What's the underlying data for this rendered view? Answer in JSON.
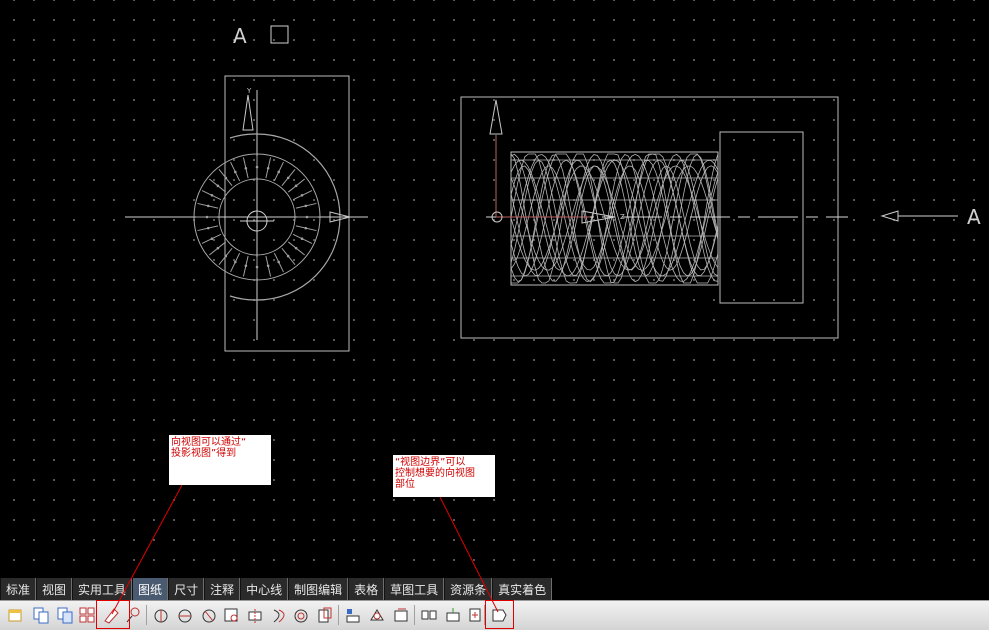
{
  "drawing": {
    "view_label_letter": "A",
    "direction_label_letter": "A"
  },
  "annotations": {
    "note1": "向视图可以通过“\n投影视图”得到",
    "note2": "“视图边界”可以\n控制想要的向视图\n部位"
  },
  "tabs": [
    {
      "label": "标准",
      "active": false
    },
    {
      "label": "视图",
      "active": false
    },
    {
      "label": "实用工具",
      "active": false
    },
    {
      "label": "图纸",
      "active": true
    },
    {
      "label": "尺寸",
      "active": false
    },
    {
      "label": "注释",
      "active": false
    },
    {
      "label": "中心线",
      "active": false
    },
    {
      "label": "制图编辑",
      "active": false
    },
    {
      "label": "表格",
      "active": false
    },
    {
      "label": "草图工具",
      "active": false
    },
    {
      "label": "资源条",
      "active": false
    },
    {
      "label": "真实着色",
      "active": false
    }
  ],
  "toolbar_icons": [
    "new-sheet-icon",
    "copy-sheet-icon",
    "paste-sheet-icon",
    "layout-icon",
    "projected-view-icon",
    "view-boundary-icon",
    "section-view-icon",
    "half-section-icon",
    "revolved-section-icon",
    "detail-view-icon",
    "break-view-icon",
    "broken-out-section-icon",
    "auxiliary-view-icon",
    "crop-view-icon",
    "align-view-icon",
    "rotate-view-icon",
    "move-view-icon",
    "scale-view-icon",
    "insert-view-icon",
    "view-properties-icon",
    "view-border-icon"
  ],
  "colors": {
    "annotation_text": "#d00000",
    "leader_line": "#e00000",
    "geometry": "#c8c8c8",
    "axis": "#c06060"
  }
}
